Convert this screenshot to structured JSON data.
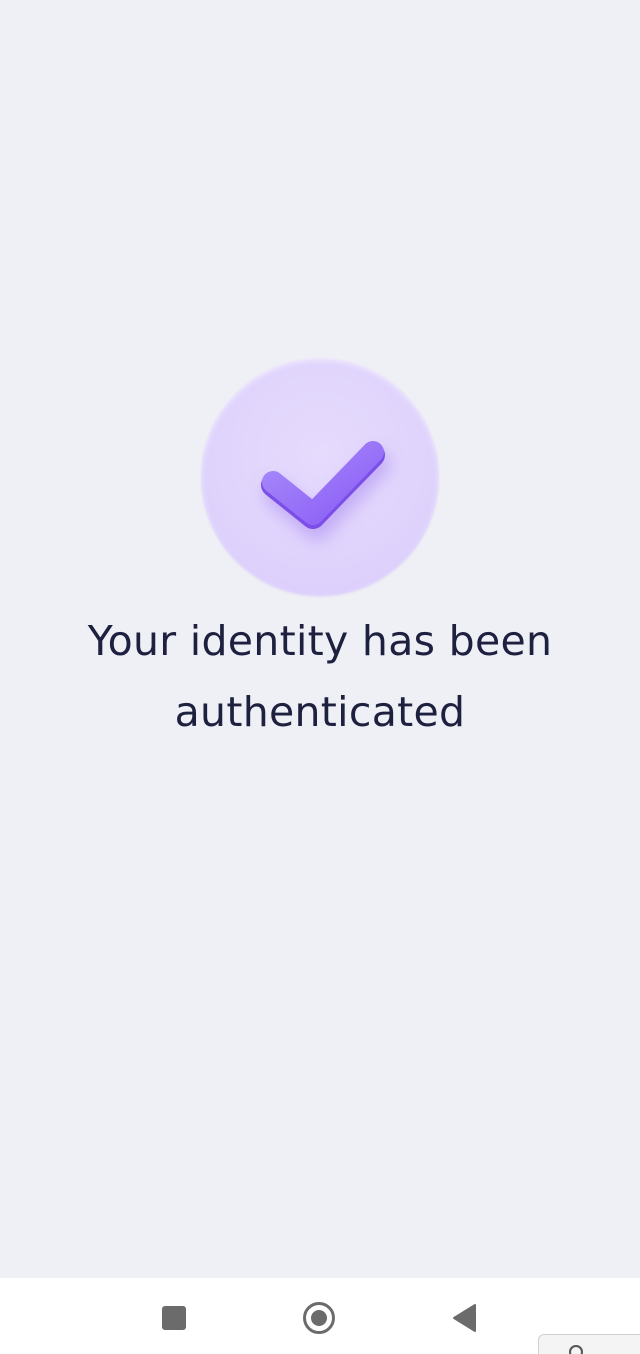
{
  "status": {
    "line1": "Your identity has been",
    "line2": "authenticated",
    "icon": "check-icon",
    "accent_color": "#8b5cf6",
    "badge_color": "#e2d6fc"
  },
  "navbar": {
    "recents_icon": "square-icon",
    "home_icon": "circle-home-icon",
    "back_icon": "triangle-back-icon"
  }
}
